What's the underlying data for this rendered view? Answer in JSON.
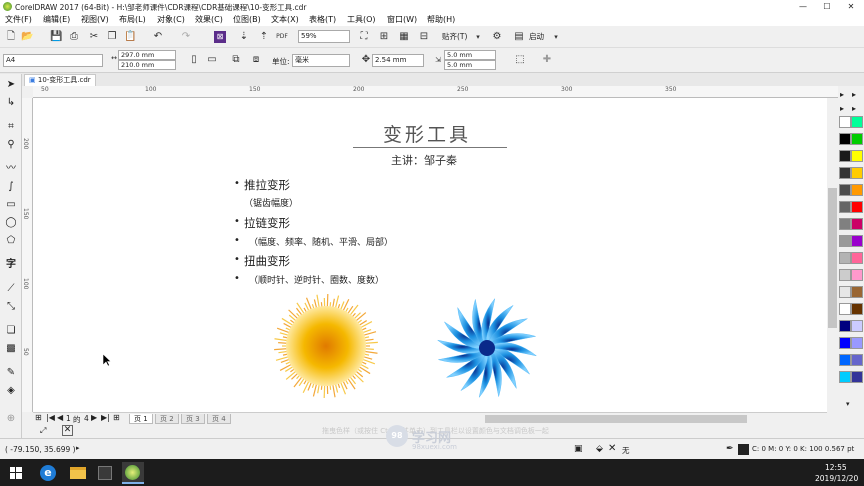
{
  "window": {
    "title": "CorelDRAW 2017 (64-Bit) - H:\\邹老师课件\\CDR课程\\CDR基础课程\\10-变形工具.cdr",
    "minimize": "—",
    "maximize": "☐",
    "close": "✕"
  },
  "menu": [
    "文件(F)",
    "编辑(E)",
    "视图(V)",
    "布局(L)",
    "对象(C)",
    "效果(C)",
    "位图(B)",
    "文本(X)",
    "表格(T)",
    "工具(O)",
    "窗口(W)",
    "帮助(H)"
  ],
  "toolbar": {
    "zoom": "59%",
    "snap_label": "贴齐(T)",
    "launch_label": "启动"
  },
  "properties": {
    "page_size": "A4",
    "width": "297.0 mm",
    "height": "210.0 mm",
    "units_label": "单位:",
    "units_value": "毫米",
    "nudge": "2.54 mm",
    "dup_x": "5.0 mm",
    "dup_y": "5.0 mm"
  },
  "doc_tab": "10-变形工具.cdr",
  "ruler": {
    "h_ticks": [
      "50",
      "100",
      "150",
      "200",
      "250",
      "300",
      "350"
    ],
    "v_ticks": [
      "200",
      "150",
      "100",
      "50"
    ]
  },
  "page": {
    "title": "变形工具",
    "speaker": "主讲：邹子秦",
    "bullets": [
      {
        "text": "推拉变形",
        "level": 0,
        "bullet": "•"
      },
      {
        "text": "（锯齿幅度）",
        "level": 1,
        "bullet": ""
      },
      {
        "text": "拉链变形",
        "level": 0,
        "bullet": "•"
      },
      {
        "text": "（幅度、频率、随机、平滑、局部）",
        "level": 1,
        "bullet": "•"
      },
      {
        "text": "扭曲变形",
        "level": 0,
        "bullet": "•"
      },
      {
        "text": "（顺时针、逆时针、圈数、度数）",
        "level": 1,
        "bullet": "•"
      }
    ]
  },
  "pages": {
    "current": "1",
    "of_label": "的",
    "total": "4",
    "tabs": [
      "页 1",
      "页 2",
      "页 3",
      "页 4"
    ]
  },
  "status": {
    "coords": "( -79.150, 35.699 )",
    "watermark_hint": "拖曳色样（或按住 Ctrl 键并单击）到工具栏以设置颜色与文档调色板一起",
    "fill_none": "无",
    "outline": "C: 0 M: 0 Y: 0 K: 100  0.567 pt",
    "watermark_site": "学习网",
    "watermark_url": "98xuexi.com"
  },
  "taskbar": {
    "time": "12:55",
    "date": "2019/12/20"
  },
  "colors": {
    "accent": "#1e4fa3",
    "star_blue": "#1a8fe0",
    "burst_yellow": "#f5b800"
  }
}
